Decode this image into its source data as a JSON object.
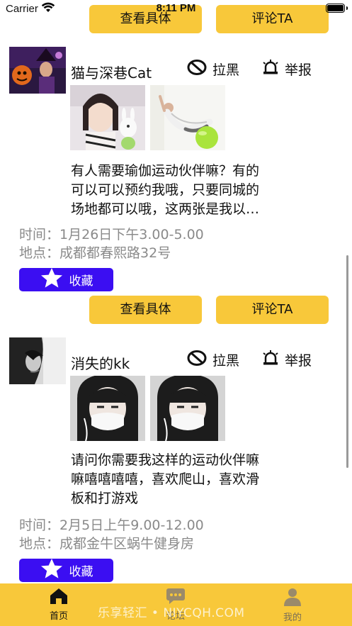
{
  "status_bar": {
    "carrier": "Carrier",
    "time": "8:11 PM"
  },
  "top_buttons": {
    "detail_label": "查看具体",
    "comment_label": "评论TA"
  },
  "posts": [
    {
      "username": "猫与深巷Cat",
      "block_label": "拉黑",
      "report_label": "举报",
      "text_line_1": "有人需要瑜伽运动伙伴嘛？有的",
      "text_line_2": "可以可以预约我哦，只要同城的",
      "text_line_3": "场地都可以哦，这两张是我以…",
      "time_label": "时间：",
      "time_value": "1月26日下午3.00-5.00",
      "place_label": "地点：",
      "place_value": "成都都春熙路32号",
      "fav_label": "收藏",
      "detail_label": "查看具体",
      "comment_label": "评论TA"
    },
    {
      "username": "消失的kk",
      "block_label": "拉黑",
      "report_label": "举报",
      "text_line_1": "请问你需要我这样的运动伙伴嘛",
      "text_line_2": "嘛嘻嘻嘻嘻，喜欢爬山，喜欢滑",
      "text_line_3": "板和打游戏",
      "time_label": "时间：",
      "time_value": "2月5日上午9.00-12.00",
      "place_label": "地点：",
      "place_value": "成都金牛区蜗牛健身房",
      "fav_label": "收藏"
    }
  ],
  "tabbar": {
    "tabs": [
      {
        "label": "首页",
        "icon": "home-icon",
        "active": true
      },
      {
        "label": "论坛",
        "icon": "chat-icon",
        "active": false
      },
      {
        "label": "我的",
        "icon": "person-icon",
        "active": false
      }
    ],
    "watermark": "乐享轻汇 • NIYCQH.COM"
  },
  "colors": {
    "accent_yellow": "#f8c83a",
    "favorite_blue": "#3b0ef2",
    "meta_gray": "#8a8a8a"
  }
}
